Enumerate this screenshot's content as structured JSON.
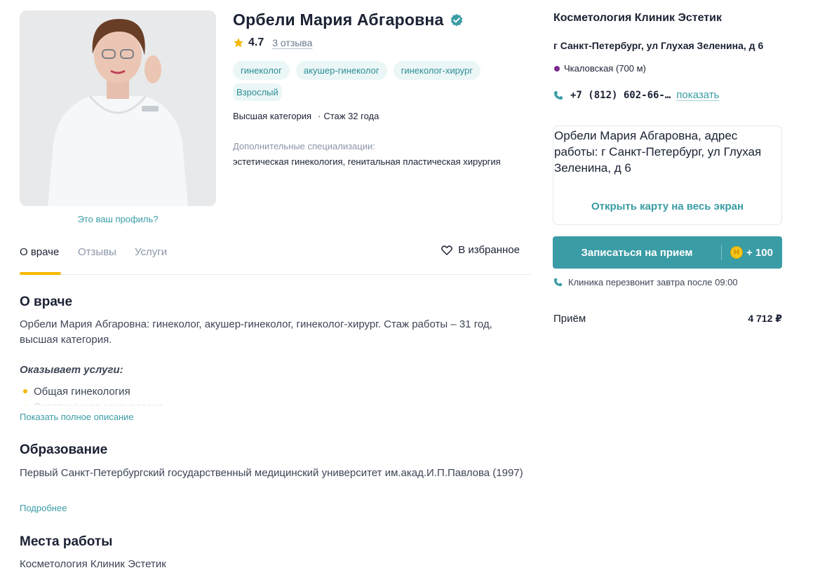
{
  "doctor": {
    "name": "Орбели Мария Абгаровна",
    "rating": "4.7",
    "reviews_link": "3 отзыва",
    "specialties": [
      "гинеколог",
      "акушер-гинеколог",
      "гинеколог-хирург"
    ],
    "age_group": "Взрослый",
    "category": "Высшая категория",
    "meta_separator": "·",
    "experience": "Стаж 32 года",
    "extra_title": "Дополнительные специализации:",
    "extra_value": "эстетическая гинекология, генитальная пластическая хирургия",
    "profile_link": "Это ваш профиль?"
  },
  "tabs": [
    {
      "label": "О враче",
      "active": true
    },
    {
      "label": "Отзывы",
      "active": false
    },
    {
      "label": "Услуги",
      "active": false
    }
  ],
  "favorite_label": "В избранное",
  "about": {
    "title": "О враче",
    "text": "Орбели Мария Абгаровна: гинеколог, акушер-гинеколог, гинеколог-хирург. Стаж работы – 31 год, высшая категория.",
    "services_title": "Оказывает услуги:",
    "services": [
      "Общая гинекология",
      "Эстетическая гинекология"
    ],
    "show_full": "Показать полное описание"
  },
  "education": {
    "title": "Образование",
    "text": "Первый Санкт-Петербургский государственный медицинский университет им.акад.И.П.Павлова (1997)",
    "more": "Подробнее"
  },
  "workplaces": {
    "title": "Места работы",
    "text": "Косметология Клиник Эстетик"
  },
  "clinic": {
    "name": "Косметология Клиник Эстетик",
    "address": "г Санкт-Петербург, ул Глухая Зеленина, д 6",
    "metro": "Чкаловская (700 м)",
    "phone": "+7 (812) 602-66-…",
    "show_phone": "показать",
    "map_address": "Орбели Мария Абгаровна, адрес работы: г Санкт-Петербург, ул Глухая Зеленина, д 6",
    "map_open": "Открыть карту на весь экран"
  },
  "booking": {
    "button_label": "Записаться на прием",
    "bonus_coin": "Н",
    "bonus": "+ 100",
    "callback": "Клиника перезвонит завтра после 09:00"
  },
  "price": {
    "label": "Приём",
    "value": "4 712 ₽"
  },
  "colors": {
    "accent": "#3a9ca5",
    "tab_underline": "#f5b800",
    "metro_line": "#7b2d8e"
  }
}
